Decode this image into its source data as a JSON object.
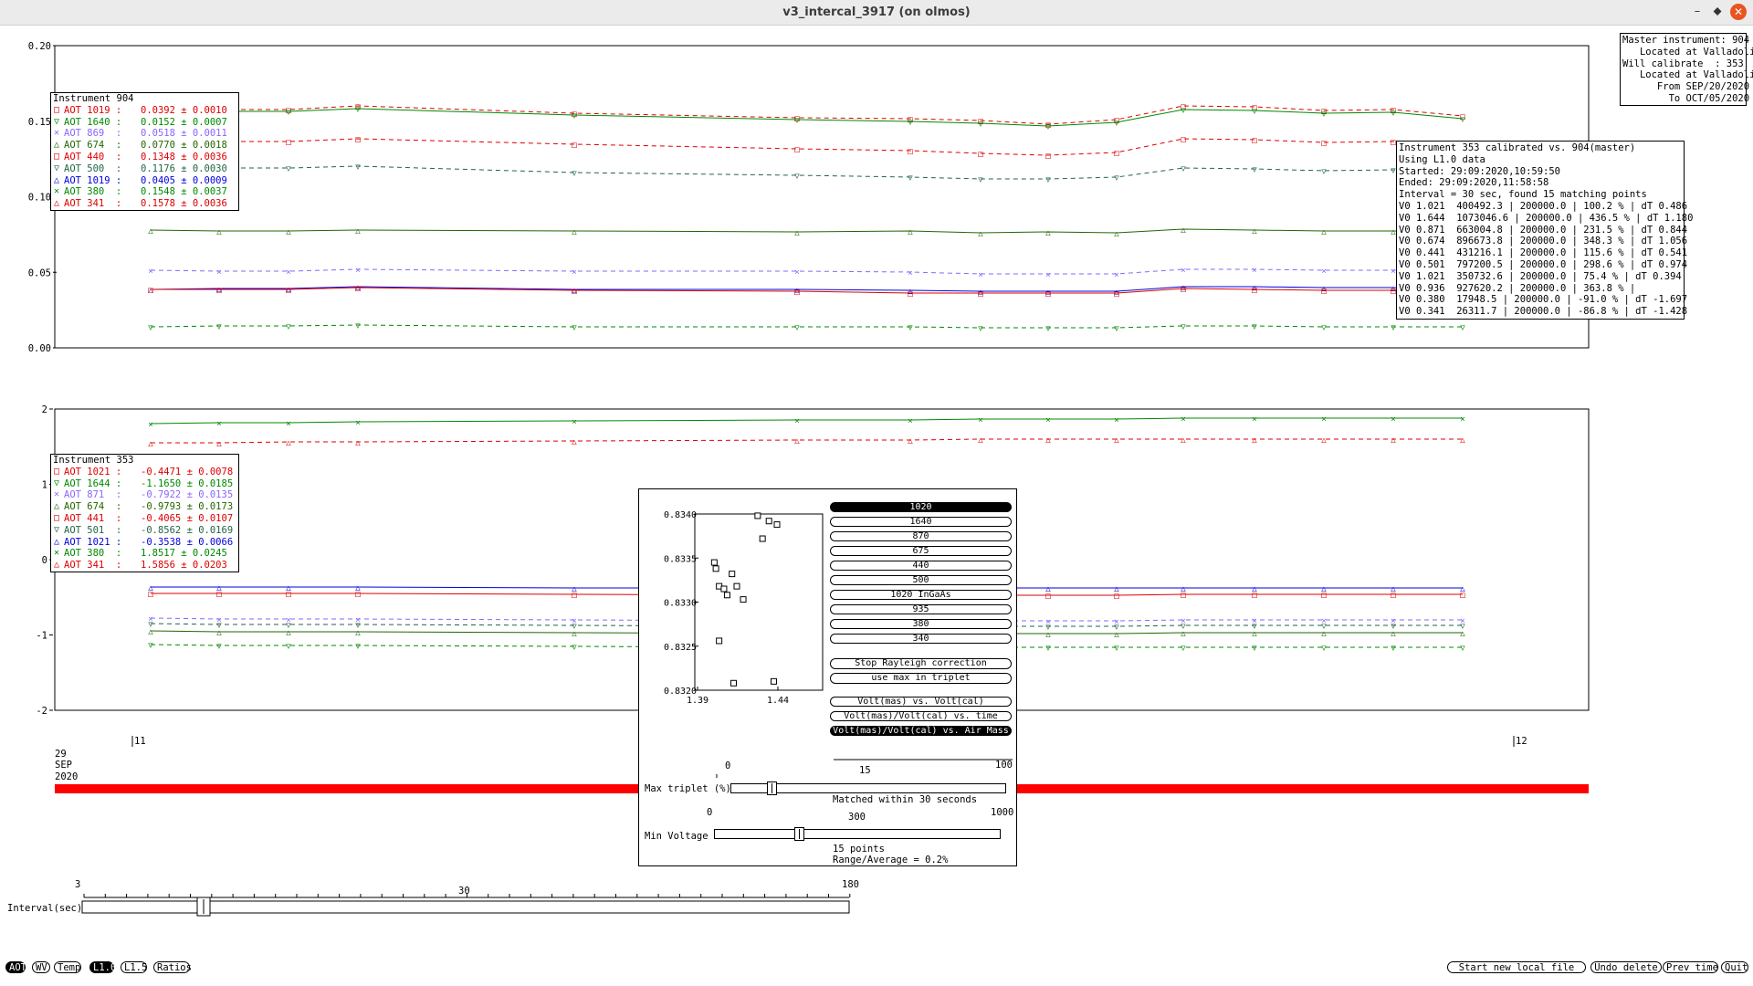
{
  "window": {
    "title": "v3_intercal_3917 (on olmos)",
    "minimize": "–",
    "maximize": "⬥",
    "close": "✕"
  },
  "top_plot": {
    "yticks": [
      "0.00",
      "0.05",
      "0.10",
      "0.15",
      "0.20"
    ],
    "legend_title": "Instrument 904",
    "legend": [
      {
        "label": "AOT 1019 :",
        "value": "0.0392 ± 0.0010",
        "color": "#dd0000",
        "marker": "□"
      },
      {
        "label": "AOT 1640 :",
        "value": "0.0152 ± 0.0007",
        "color": "#008800",
        "marker": "▽"
      },
      {
        "label": "AOT 869  :",
        "value": "0.0518 ± 0.0011",
        "color": "#8866ff",
        "marker": "✕"
      },
      {
        "label": "AOT 674  :",
        "value": "0.0770 ± 0.0018",
        "color": "#226600",
        "marker": "△"
      },
      {
        "label": "AOT 440  :",
        "value": "0.1348 ± 0.0036",
        "color": "#dd0000",
        "marker": "□"
      },
      {
        "label": "AOT 500  :",
        "value": "0.1176 ± 0.0030",
        "color": "#226644",
        "marker": "▽"
      },
      {
        "label": "AOT 1019 :",
        "value": "0.0405 ± 0.0009",
        "color": "#0000dd",
        "marker": "△"
      },
      {
        "label": "AOT 380  :",
        "value": "0.1548 ± 0.0037",
        "color": "#008800",
        "marker": "✕"
      },
      {
        "label": "AOT 341  :",
        "value": "0.1578 ± 0.0036",
        "color": "#dd0000",
        "marker": "△"
      }
    ]
  },
  "bottom_plot": {
    "yticks": [
      "-2",
      "-1",
      "0",
      "1",
      "2"
    ],
    "legend_title": "Instrument 353",
    "legend": [
      {
        "label": "AOT 1021 :",
        "value": "-0.4471 ± 0.0078",
        "color": "#dd0000",
        "marker": "□"
      },
      {
        "label": "AOT 1644 :",
        "value": "-1.1650 ± 0.0185",
        "color": "#008800",
        "marker": "▽"
      },
      {
        "label": "AOT 871  :",
        "value": "-0.7922 ± 0.0135",
        "color": "#8866ff",
        "marker": "✕"
      },
      {
        "label": "AOT 674  :",
        "value": "-0.9793 ± 0.0173",
        "color": "#226600",
        "marker": "△"
      },
      {
        "label": "AOT 441  :",
        "value": "-0.4065 ± 0.0107",
        "color": "#dd0000",
        "marker": "□"
      },
      {
        "label": "AOT 501  :",
        "value": "-0.8562 ± 0.0169",
        "color": "#226644",
        "marker": "▽"
      },
      {
        "label": "AOT 1021 :",
        "value": "-0.3538 ± 0.0066",
        "color": "#0000dd",
        "marker": "△"
      },
      {
        "label": "AOT 380  :",
        "value": "1.8517 ± 0.0245",
        "color": "#008800",
        "marker": "✕"
      },
      {
        "label": "AOT 341  :",
        "value": "1.5856 ± 0.0203",
        "color": "#dd0000",
        "marker": "△"
      }
    ]
  },
  "master_box": [
    "Master instrument: 904",
    "   Located at Valladolid",
    "Will calibrate  : 353",
    "   Located at Valladolid",
    "      From SEP/20/2020",
    "        To OCT/05/2020"
  ],
  "calib_box": [
    "Instrument 353 calibrated vs. 904(master)",
    "Using L1.0 data",
    "Started: 29:09:2020,10:59:50",
    "Ended: 29:09:2020,11:58:58",
    "Interval = 30 sec, found 15 matching points",
    "V0 1.021  400492.3 | 200000.0 | 100.2 % | dT 0.486",
    "V0 1.644  1073046.6 | 200000.0 | 436.5 % | dT 1.180",
    "V0 0.871  663004.8 | 200000.0 | 231.5 % | dT 0.844",
    "V0 0.674  896673.8 | 200000.0 | 348.3 % | dT 1.056",
    "V0 0.441  431216.1 | 200000.0 | 115.6 % | dT 0.541",
    "V0 0.501  797200.5 | 200000.0 | 298.6 % | dT 0.974",
    "V0 1.021  350732.6 | 200000.0 | 75.4 % | dT 0.394",
    "V0 0.936  927620.2 | 200000.0 | 363.8 % |",
    "V0 0.380  17948.5 | 200000.0 | -91.0 % | dT -1.697",
    "V0 0.341  26311.7 | 200000.0 | -86.8 % | dT -1.428"
  ],
  "time_axis": {
    "start_tick": "11",
    "end_tick": "12",
    "day": "29",
    "month": "SEP",
    "year": "2020"
  },
  "popup": {
    "scatter": {
      "yticks": [
        "0.8340",
        "0.8335",
        "0.8330",
        "0.8325",
        "0.8320"
      ],
      "xticks": [
        "1.39",
        "1.44"
      ]
    },
    "wavelength_buttons": [
      "1020",
      "1640",
      "870",
      "675",
      "440",
      "500",
      "1020 InGaAs",
      "935",
      "380",
      "340"
    ],
    "stop_rayleigh": "Stop Rayleigh correction",
    "use_max": "use max in triplet",
    "mode_buttons": [
      "Volt(mas) vs. Volt(cal)",
      "Volt(mas)/Volt(cal) vs. time",
      "Volt(mas)/Volt(cal) vs. Air Mass"
    ],
    "max_triplet": {
      "label": "Max triplet (%)",
      "min": "0",
      "mid": "15",
      "max": "100",
      "status": "Matched within 30 seconds"
    },
    "min_voltage": {
      "label": "Min Voltage",
      "min": "0",
      "mid": "300",
      "max": "1000",
      "status1": "15 points",
      "status2": "Range/Average = 0.2%"
    }
  },
  "interval_slider": {
    "label": "Interval(sec)",
    "min": "3",
    "mid": "30",
    "max": "180"
  },
  "bottom_left_buttons": [
    "AOT",
    "WV",
    "Temp",
    "L1.0",
    "L1.5",
    "Ratios"
  ],
  "bottom_right_buttons": [
    "Start new local file",
    "Undo delete",
    "Prev time",
    "Quit"
  ],
  "chart_data": {
    "type": "scatter",
    "xticks": [
      "1.39",
      "1.44"
    ],
    "yticks": [
      "0.8340",
      "0.8335",
      "0.8330",
      "0.8325",
      "0.8320"
    ],
    "xlim": [
      1.39,
      1.44
    ],
    "ylim": [
      0.832,
      0.834
    ],
    "points": [
      [
        1.402,
        0.83338
      ],
      [
        1.401,
        0.83345
      ],
      [
        1.404,
        0.83318
      ],
      [
        1.407,
        0.83315
      ],
      [
        1.409,
        0.83308
      ],
      [
        1.412,
        0.83332
      ],
      [
        1.415,
        0.83318
      ],
      [
        1.419,
        0.83303
      ],
      [
        1.404,
        0.83256
      ],
      [
        1.413,
        0.83208
      ],
      [
        1.428,
        0.83398
      ],
      [
        1.431,
        0.83372
      ],
      [
        1.435,
        0.83392
      ],
      [
        1.44,
        0.83388
      ],
      [
        1.438,
        0.8321
      ]
    ]
  }
}
